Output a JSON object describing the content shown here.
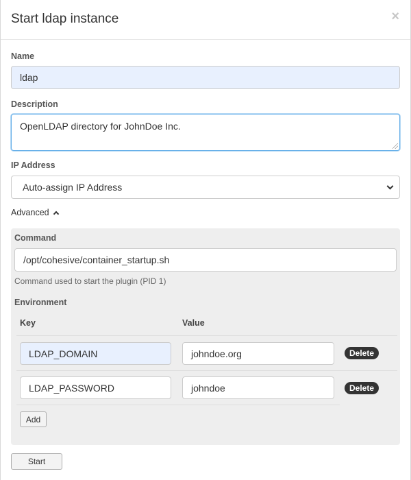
{
  "modal": {
    "title": "Start ldap instance",
    "close_glyph": "×"
  },
  "form": {
    "name_label": "Name",
    "name_value": "ldap",
    "description_label": "Description",
    "description_value": "OpenLDAP directory for JohnDoe Inc.",
    "ip_label": "IP Address",
    "ip_selected": "Auto-assign IP Address",
    "advanced_label": "Advanced"
  },
  "advanced": {
    "command_label": "Command",
    "command_value": "/opt/cohesive/container_startup.sh",
    "command_help": "Command used to start the plugin (PID 1)",
    "environment_label": "Environment",
    "key_header": "Key",
    "value_header": "Value",
    "rows": [
      {
        "key": "LDAP_DOMAIN",
        "value": "johndoe.org",
        "delete_label": "Delete"
      },
      {
        "key": "LDAP_PASSWORD",
        "value": "johndoe",
        "delete_label": "Delete"
      }
    ],
    "add_label": "Add"
  },
  "footer": {
    "start_label": "Start"
  }
}
